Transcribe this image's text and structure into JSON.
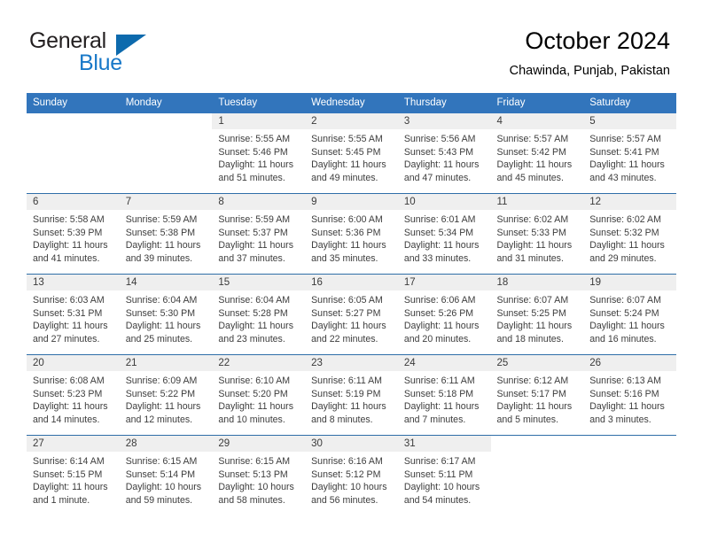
{
  "brand": {
    "word1": "General",
    "word2": "Blue",
    "flag_icon": "triangle-flag-icon",
    "accent_color": "#1878c8",
    "flag_color": "#0d6aad"
  },
  "header": {
    "title": "October 2024",
    "subtitle": "Chawinda, Punjab, Pakistan"
  },
  "calendar": {
    "header_bg": "#3275bc",
    "daynum_bg": "#efefef",
    "separator_color": "#2f6ea8",
    "weekday_headers": [
      "Sunday",
      "Monday",
      "Tuesday",
      "Wednesday",
      "Thursday",
      "Friday",
      "Saturday"
    ],
    "weeks": [
      [
        {
          "day": "",
          "sunrise": "",
          "sunset": "",
          "daylight_line1": "",
          "daylight_line2": ""
        },
        {
          "day": "",
          "sunrise": "",
          "sunset": "",
          "daylight_line1": "",
          "daylight_line2": ""
        },
        {
          "day": "1",
          "sunrise": "Sunrise: 5:55 AM",
          "sunset": "Sunset: 5:46 PM",
          "daylight_line1": "Daylight: 11 hours",
          "daylight_line2": "and 51 minutes."
        },
        {
          "day": "2",
          "sunrise": "Sunrise: 5:55 AM",
          "sunset": "Sunset: 5:45 PM",
          "daylight_line1": "Daylight: 11 hours",
          "daylight_line2": "and 49 minutes."
        },
        {
          "day": "3",
          "sunrise": "Sunrise: 5:56 AM",
          "sunset": "Sunset: 5:43 PM",
          "daylight_line1": "Daylight: 11 hours",
          "daylight_line2": "and 47 minutes."
        },
        {
          "day": "4",
          "sunrise": "Sunrise: 5:57 AM",
          "sunset": "Sunset: 5:42 PM",
          "daylight_line1": "Daylight: 11 hours",
          "daylight_line2": "and 45 minutes."
        },
        {
          "day": "5",
          "sunrise": "Sunrise: 5:57 AM",
          "sunset": "Sunset: 5:41 PM",
          "daylight_line1": "Daylight: 11 hours",
          "daylight_line2": "and 43 minutes."
        }
      ],
      [
        {
          "day": "6",
          "sunrise": "Sunrise: 5:58 AM",
          "sunset": "Sunset: 5:39 PM",
          "daylight_line1": "Daylight: 11 hours",
          "daylight_line2": "and 41 minutes."
        },
        {
          "day": "7",
          "sunrise": "Sunrise: 5:59 AM",
          "sunset": "Sunset: 5:38 PM",
          "daylight_line1": "Daylight: 11 hours",
          "daylight_line2": "and 39 minutes."
        },
        {
          "day": "8",
          "sunrise": "Sunrise: 5:59 AM",
          "sunset": "Sunset: 5:37 PM",
          "daylight_line1": "Daylight: 11 hours",
          "daylight_line2": "and 37 minutes."
        },
        {
          "day": "9",
          "sunrise": "Sunrise: 6:00 AM",
          "sunset": "Sunset: 5:36 PM",
          "daylight_line1": "Daylight: 11 hours",
          "daylight_line2": "and 35 minutes."
        },
        {
          "day": "10",
          "sunrise": "Sunrise: 6:01 AM",
          "sunset": "Sunset: 5:34 PM",
          "daylight_line1": "Daylight: 11 hours",
          "daylight_line2": "and 33 minutes."
        },
        {
          "day": "11",
          "sunrise": "Sunrise: 6:02 AM",
          "sunset": "Sunset: 5:33 PM",
          "daylight_line1": "Daylight: 11 hours",
          "daylight_line2": "and 31 minutes."
        },
        {
          "day": "12",
          "sunrise": "Sunrise: 6:02 AM",
          "sunset": "Sunset: 5:32 PM",
          "daylight_line1": "Daylight: 11 hours",
          "daylight_line2": "and 29 minutes."
        }
      ],
      [
        {
          "day": "13",
          "sunrise": "Sunrise: 6:03 AM",
          "sunset": "Sunset: 5:31 PM",
          "daylight_line1": "Daylight: 11 hours",
          "daylight_line2": "and 27 minutes."
        },
        {
          "day": "14",
          "sunrise": "Sunrise: 6:04 AM",
          "sunset": "Sunset: 5:30 PM",
          "daylight_line1": "Daylight: 11 hours",
          "daylight_line2": "and 25 minutes."
        },
        {
          "day": "15",
          "sunrise": "Sunrise: 6:04 AM",
          "sunset": "Sunset: 5:28 PM",
          "daylight_line1": "Daylight: 11 hours",
          "daylight_line2": "and 23 minutes."
        },
        {
          "day": "16",
          "sunrise": "Sunrise: 6:05 AM",
          "sunset": "Sunset: 5:27 PM",
          "daylight_line1": "Daylight: 11 hours",
          "daylight_line2": "and 22 minutes."
        },
        {
          "day": "17",
          "sunrise": "Sunrise: 6:06 AM",
          "sunset": "Sunset: 5:26 PM",
          "daylight_line1": "Daylight: 11 hours",
          "daylight_line2": "and 20 minutes."
        },
        {
          "day": "18",
          "sunrise": "Sunrise: 6:07 AM",
          "sunset": "Sunset: 5:25 PM",
          "daylight_line1": "Daylight: 11 hours",
          "daylight_line2": "and 18 minutes."
        },
        {
          "day": "19",
          "sunrise": "Sunrise: 6:07 AM",
          "sunset": "Sunset: 5:24 PM",
          "daylight_line1": "Daylight: 11 hours",
          "daylight_line2": "and 16 minutes."
        }
      ],
      [
        {
          "day": "20",
          "sunrise": "Sunrise: 6:08 AM",
          "sunset": "Sunset: 5:23 PM",
          "daylight_line1": "Daylight: 11 hours",
          "daylight_line2": "and 14 minutes."
        },
        {
          "day": "21",
          "sunrise": "Sunrise: 6:09 AM",
          "sunset": "Sunset: 5:22 PM",
          "daylight_line1": "Daylight: 11 hours",
          "daylight_line2": "and 12 minutes."
        },
        {
          "day": "22",
          "sunrise": "Sunrise: 6:10 AM",
          "sunset": "Sunset: 5:20 PM",
          "daylight_line1": "Daylight: 11 hours",
          "daylight_line2": "and 10 minutes."
        },
        {
          "day": "23",
          "sunrise": "Sunrise: 6:11 AM",
          "sunset": "Sunset: 5:19 PM",
          "daylight_line1": "Daylight: 11 hours",
          "daylight_line2": "and 8 minutes."
        },
        {
          "day": "24",
          "sunrise": "Sunrise: 6:11 AM",
          "sunset": "Sunset: 5:18 PM",
          "daylight_line1": "Daylight: 11 hours",
          "daylight_line2": "and 7 minutes."
        },
        {
          "day": "25",
          "sunrise": "Sunrise: 6:12 AM",
          "sunset": "Sunset: 5:17 PM",
          "daylight_line1": "Daylight: 11 hours",
          "daylight_line2": "and 5 minutes."
        },
        {
          "day": "26",
          "sunrise": "Sunrise: 6:13 AM",
          "sunset": "Sunset: 5:16 PM",
          "daylight_line1": "Daylight: 11 hours",
          "daylight_line2": "and 3 minutes."
        }
      ],
      [
        {
          "day": "27",
          "sunrise": "Sunrise: 6:14 AM",
          "sunset": "Sunset: 5:15 PM",
          "daylight_line1": "Daylight: 11 hours",
          "daylight_line2": "and 1 minute."
        },
        {
          "day": "28",
          "sunrise": "Sunrise: 6:15 AM",
          "sunset": "Sunset: 5:14 PM",
          "daylight_line1": "Daylight: 10 hours",
          "daylight_line2": "and 59 minutes."
        },
        {
          "day": "29",
          "sunrise": "Sunrise: 6:15 AM",
          "sunset": "Sunset: 5:13 PM",
          "daylight_line1": "Daylight: 10 hours",
          "daylight_line2": "and 58 minutes."
        },
        {
          "day": "30",
          "sunrise": "Sunrise: 6:16 AM",
          "sunset": "Sunset: 5:12 PM",
          "daylight_line1": "Daylight: 10 hours",
          "daylight_line2": "and 56 minutes."
        },
        {
          "day": "31",
          "sunrise": "Sunrise: 6:17 AM",
          "sunset": "Sunset: 5:11 PM",
          "daylight_line1": "Daylight: 10 hours",
          "daylight_line2": "and 54 minutes."
        },
        {
          "day": "",
          "sunrise": "",
          "sunset": "",
          "daylight_line1": "",
          "daylight_line2": ""
        },
        {
          "day": "",
          "sunrise": "",
          "sunset": "",
          "daylight_line1": "",
          "daylight_line2": ""
        }
      ]
    ]
  }
}
